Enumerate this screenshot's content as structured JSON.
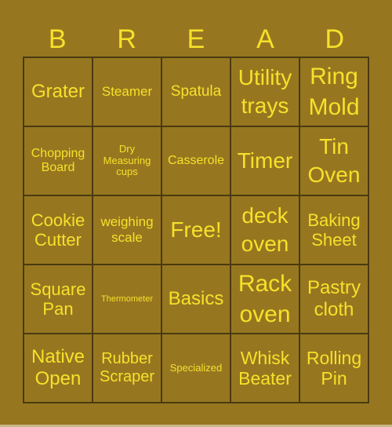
{
  "header": [
    "B",
    "R",
    "E",
    "A",
    "D"
  ],
  "cells": [
    [
      "Grater",
      "Steamer",
      "Spatula",
      "Utility trays",
      "Ring Mold"
    ],
    [
      "Chopping Board",
      "Dry Measuring cups",
      "Casserole",
      "Timer",
      "Tin Oven"
    ],
    [
      "Cookie Cutter",
      "weighing scale",
      "Free!",
      "deck oven",
      "Baking Sheet"
    ],
    [
      "Square Pan",
      "Thermometer",
      "Basics",
      "Rack oven",
      "Pastry cloth"
    ],
    [
      "Native Open",
      "Rubber Scraper",
      "Specialized",
      "Whisk Beater",
      "Rolling Pin"
    ]
  ],
  "colors": {
    "background": "#967720",
    "text": "#f6e12a",
    "grid_lines": "#4a3a10"
  }
}
